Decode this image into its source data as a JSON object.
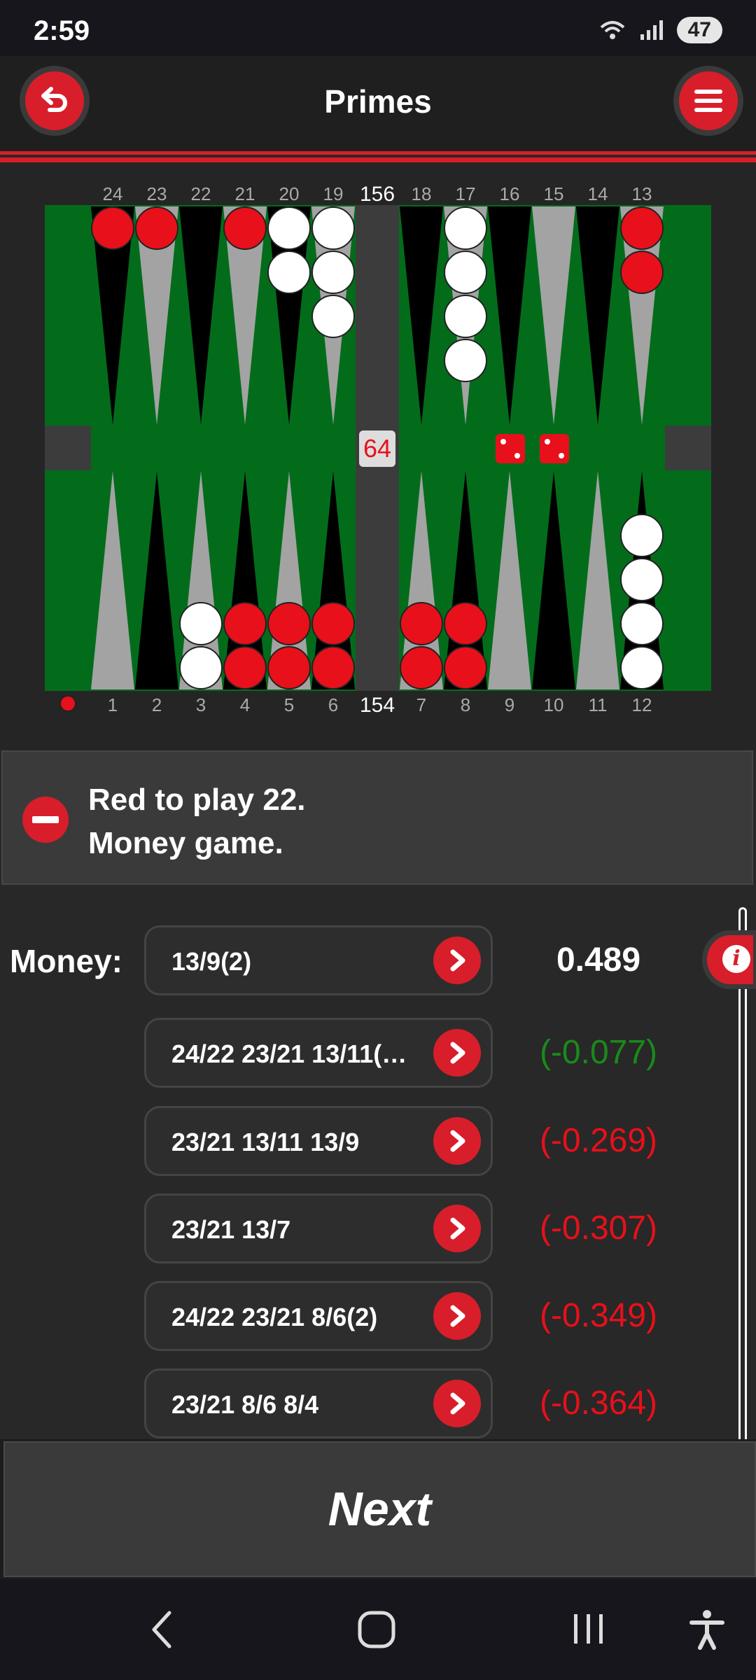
{
  "status": {
    "time": "2:59",
    "battery": "47"
  },
  "header": {
    "title": "Primes"
  },
  "board": {
    "top_points": [
      "24",
      "23",
      "22",
      "21",
      "20",
      "19",
      "18",
      "17",
      "16",
      "15",
      "14",
      "13"
    ],
    "bottom_points": [
      "1",
      "2",
      "3",
      "4",
      "5",
      "6",
      "7",
      "8",
      "9",
      "10",
      "11",
      "12"
    ],
    "pip_top": "156",
    "pip_bottom": "154",
    "cube": "64",
    "dice": [
      2,
      2
    ],
    "colors": {
      "red": "#e8101a",
      "white": "#ffffff",
      "felt": "#036c1b",
      "dark_point": "#000000",
      "light_point": "#a3a3a3",
      "bar": "#3c3c3c"
    },
    "checkers": {
      "24": {
        "color": "red",
        "count": 1
      },
      "23": {
        "color": "red",
        "count": 1
      },
      "21": {
        "color": "red",
        "count": 1
      },
      "20": {
        "color": "white",
        "count": 2
      },
      "19": {
        "color": "white",
        "count": 3
      },
      "17": {
        "color": "white",
        "count": 4
      },
      "13": {
        "color": "red",
        "count": 2
      },
      "12": {
        "color": "white",
        "count": 4
      },
      "8": {
        "color": "red",
        "count": 2
      },
      "7": {
        "color": "red",
        "count": 2
      },
      "6": {
        "color": "red",
        "count": 2
      },
      "5": {
        "color": "red",
        "count": 2
      },
      "4": {
        "color": "red",
        "count": 2
      },
      "3": {
        "color": "white",
        "count": 2
      }
    }
  },
  "info": {
    "line1": "Red to play 22.",
    "line2": "Money game."
  },
  "analysis": {
    "label": "Money:",
    "moves": [
      {
        "move": "13/9(2)",
        "equity": "0.489",
        "color": "#ffffff"
      },
      {
        "move": "24/22 23/21 13/11(…",
        "equity": "(-0.077)",
        "color": "#1a8a1a"
      },
      {
        "move": "23/21 13/11 13/9",
        "equity": "(-0.269)",
        "color": "#e8101a"
      },
      {
        "move": "23/21 13/7",
        "equity": "(-0.307)",
        "color": "#e8101a"
      },
      {
        "move": "24/22 23/21 8/6(2)",
        "equity": "(-0.349)",
        "color": "#e8101a"
      },
      {
        "move": "23/21 8/6 8/4",
        "equity": "(-0.364)",
        "color": "#e8101a"
      }
    ]
  },
  "next": {
    "label": "Next"
  },
  "icons": {
    "back": "undo-arrow-icon",
    "menu": "hamburger-menu-icon",
    "info_minus": "minus-circle-icon",
    "go": "chevron-right-icon",
    "info": "info-icon"
  }
}
